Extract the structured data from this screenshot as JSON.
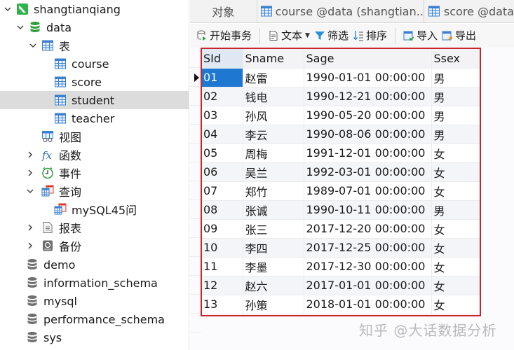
{
  "sidebar": {
    "connection": {
      "label": "shangtianqiang",
      "icon": "connection-icon",
      "expanded": true
    },
    "database": {
      "label": "data",
      "icon": "database-icon",
      "expanded": true
    },
    "tables_group": {
      "label": "表",
      "icon": "table-icon",
      "expanded": true
    },
    "tables": [
      {
        "label": "course",
        "icon": "table-icon"
      },
      {
        "label": "score",
        "icon": "table-icon"
      },
      {
        "label": "student",
        "icon": "table-icon",
        "selected": true
      },
      {
        "label": "teacher",
        "icon": "table-icon"
      }
    ],
    "views": {
      "label": "视图",
      "icon": "view-icon"
    },
    "functions": {
      "label": "函数",
      "icon": "function-icon",
      "expanded": false
    },
    "events": {
      "label": "事件",
      "icon": "clock-icon",
      "expanded": false
    },
    "queries": {
      "label": "查询",
      "icon": "query-icon",
      "expanded": true
    },
    "query_items": [
      {
        "label": "mySQL45问",
        "icon": "query-icon"
      }
    ],
    "reports": {
      "label": "报表",
      "icon": "report-icon",
      "expanded": false
    },
    "backups": {
      "label": "备份",
      "icon": "backup-icon",
      "expanded": false
    },
    "other_databases": [
      {
        "label": "demo",
        "icon": "database-icon"
      },
      {
        "label": "information_schema",
        "icon": "database-icon"
      },
      {
        "label": "mysql",
        "icon": "database-icon"
      },
      {
        "label": "performance_schema",
        "icon": "database-icon"
      },
      {
        "label": "sys",
        "icon": "database-icon"
      }
    ]
  },
  "tabs": [
    {
      "label": "对象"
    },
    {
      "label": "course @data (shangtian...",
      "icon": "table-icon"
    },
    {
      "label": "score @data",
      "icon": "table-icon"
    }
  ],
  "toolbar": {
    "begin_transaction": "开始事务",
    "text": "文本",
    "filter": "筛选",
    "sort": "排序",
    "import": "导入",
    "export": "导出"
  },
  "grid": {
    "columns": [
      "SId",
      "Sname",
      "Sage",
      "Ssex"
    ],
    "rows": [
      [
        "01",
        "赵雷",
        "1990-01-01 00:00:00",
        "男"
      ],
      [
        "02",
        "钱电",
        "1990-12-21 00:00:00",
        "男"
      ],
      [
        "03",
        "孙风",
        "1990-05-20 00:00:00",
        "男"
      ],
      [
        "04",
        "李云",
        "1990-08-06 00:00:00",
        "男"
      ],
      [
        "05",
        "周梅",
        "1991-12-01 00:00:00",
        "女"
      ],
      [
        "06",
        "吴兰",
        "1992-03-01 00:00:00",
        "女"
      ],
      [
        "07",
        "郑竹",
        "1989-07-01 00:00:00",
        "女"
      ],
      [
        "08",
        "张诚",
        "1990-10-11 00:00:00",
        "男"
      ],
      [
        "09",
        "张三",
        "2017-12-20 00:00:00",
        "女"
      ],
      [
        "10",
        "李四",
        "2017-12-25 00:00:00",
        "女"
      ],
      [
        "11",
        "李墨",
        "2017-12-30 00:00:00",
        "女"
      ],
      [
        "12",
        "赵六",
        "2017-01-01 00:00:00",
        "女"
      ],
      [
        "13",
        "孙策",
        "2018-01-01 00:00:00",
        "女"
      ]
    ],
    "active_cell": {
      "row": 0,
      "col": 0
    }
  },
  "colors": {
    "selection": "#1e78d2",
    "highlight_box": "#c8242b",
    "db_green": "#2e9e3a",
    "table_blue": "#3a7fd0"
  },
  "watermark": "知乎 @大话数据分析"
}
